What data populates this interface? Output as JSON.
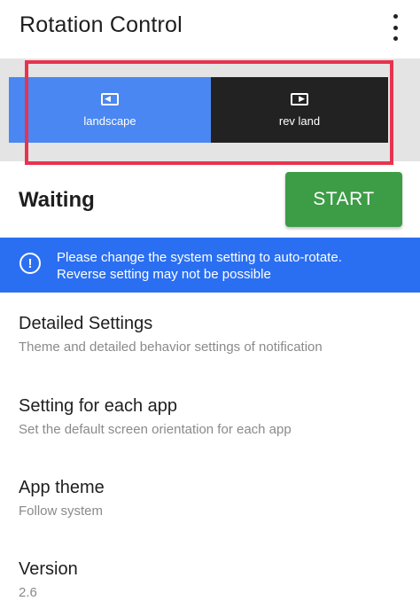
{
  "app": {
    "title": "Rotation Control",
    "menu_icon": "more-vert-icon"
  },
  "modes": [
    {
      "label": "landscape",
      "icon": "landscape-icon",
      "active": true
    },
    {
      "label": "rev land",
      "icon": "reverse-landscape-icon",
      "active": false
    }
  ],
  "status": {
    "text": "Waiting",
    "start_label": "START"
  },
  "banner": {
    "icon": "info-icon",
    "line1": "Please change the system setting to auto-rotate.",
    "line2": "Reverse setting may not be possible"
  },
  "settings": [
    {
      "title": "Detailed Settings",
      "subtitle": "Theme and detailed behavior settings of notification"
    },
    {
      "title": "Setting for each app",
      "subtitle": "Set the default screen orientation for each app"
    },
    {
      "title": "App theme",
      "subtitle": "Follow system"
    },
    {
      "title": "Version",
      "subtitle": "2.6"
    }
  ],
  "colors": {
    "active_mode": "#4a87f2",
    "inactive_mode": "#222222",
    "start_button": "#3d9c46",
    "banner": "#2a6ff2",
    "highlight": "#e8334f"
  }
}
